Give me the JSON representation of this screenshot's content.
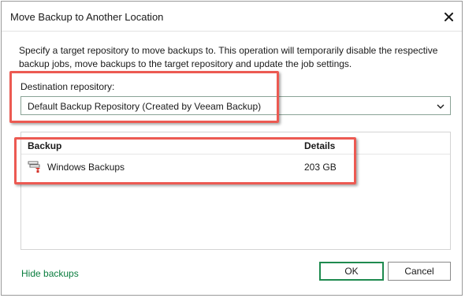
{
  "dialog": {
    "title": "Move Backup to Another Location",
    "description": "Specify a target repository to move backups to. This operation will temporarily disable the respective backup jobs, move backups to the target repository and update the job settings."
  },
  "destination": {
    "label": "Destination repository:",
    "selected": "Default Backup Repository (Created by Veeam Backup)"
  },
  "table": {
    "columns": [
      "Backup",
      "Details"
    ],
    "rows": [
      {
        "name": "Windows Backups",
        "details": "203 GB",
        "icon": "backup-job-icon"
      }
    ]
  },
  "footer": {
    "hide_link": "Hide backups",
    "ok_label": "OK",
    "cancel_label": "Cancel"
  },
  "colors": {
    "accent": "#1e8a4f",
    "link": "#0a7d3e",
    "highlight": "#ec5a52"
  }
}
